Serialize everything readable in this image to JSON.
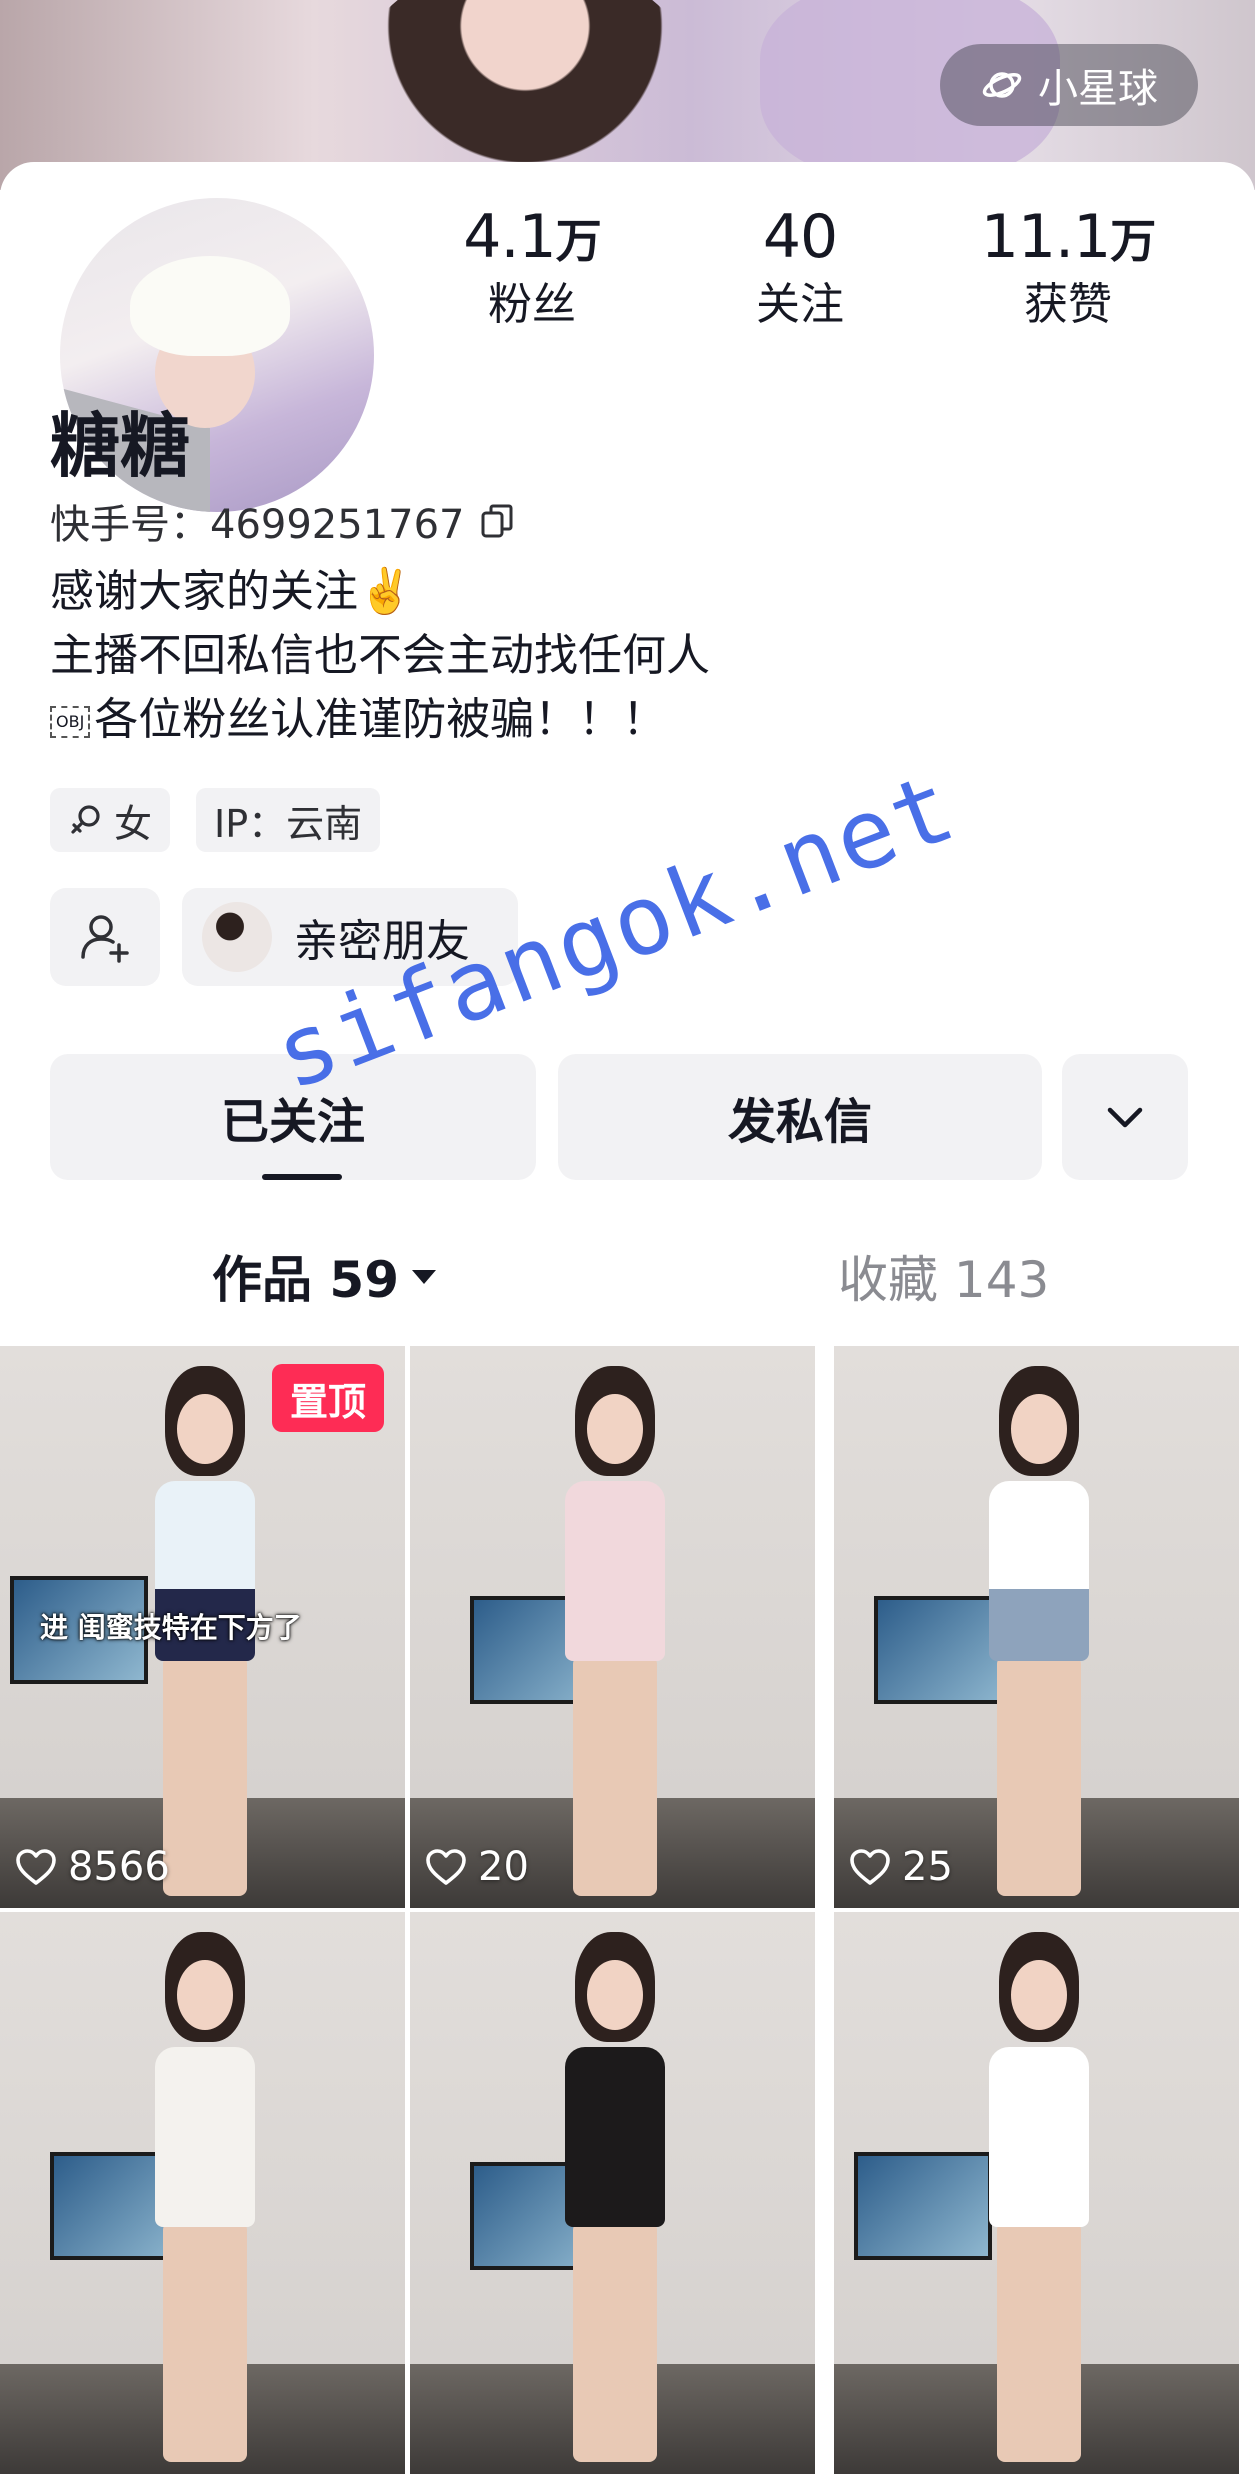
{
  "planet": {
    "label": "小星球"
  },
  "stats": [
    {
      "num": "4.1",
      "unit": "万",
      "label": "粉丝"
    },
    {
      "num": "40",
      "unit": "",
      "label": "关注"
    },
    {
      "num": "11.1",
      "unit": "万",
      "label": "获赞"
    }
  ],
  "profile": {
    "name": "糖糖",
    "uid": "快手号：4699251767",
    "bio": [
      "感谢大家的关注✌️",
      "主播不回私信也不会主动找任何人",
      "各位粉丝认准谨防被骗！！！"
    ],
    "bio_obj_glyph": "OBJ",
    "gender": "女",
    "ip": "IP：云南"
  },
  "friends_chip": {
    "label": "亲密朋友"
  },
  "actions": {
    "following": "已关注",
    "message": "发私信"
  },
  "tabs": {
    "works": "作品 59",
    "collect": "收藏 143"
  },
  "videos": [
    {
      "likes": "8566",
      "pinned": "置顶",
      "caption": "进 闺蜜技特在下方了",
      "top": "#e9f2f8",
      "bottom": "#23284a"
    },
    {
      "likes": "20",
      "pinned": "",
      "caption": "",
      "top": "#f1d8dc",
      "bottom": "#f1d8dc"
    },
    {
      "likes": "25",
      "pinned": "",
      "caption": "",
      "top": "#ffffff",
      "bottom": "#8ea3bc"
    },
    {
      "likes": "",
      "pinned": "",
      "caption": "",
      "top": "#f4f2ee",
      "bottom": "#f4f2ee"
    },
    {
      "likes": "",
      "pinned": "",
      "caption": "",
      "top": "#1c1a1b",
      "bottom": "#1c1a1b"
    },
    {
      "likes": "",
      "pinned": "",
      "caption": "",
      "top": "#ffffff",
      "bottom": "#ffffff"
    }
  ],
  "watermark": "sifangok.net"
}
